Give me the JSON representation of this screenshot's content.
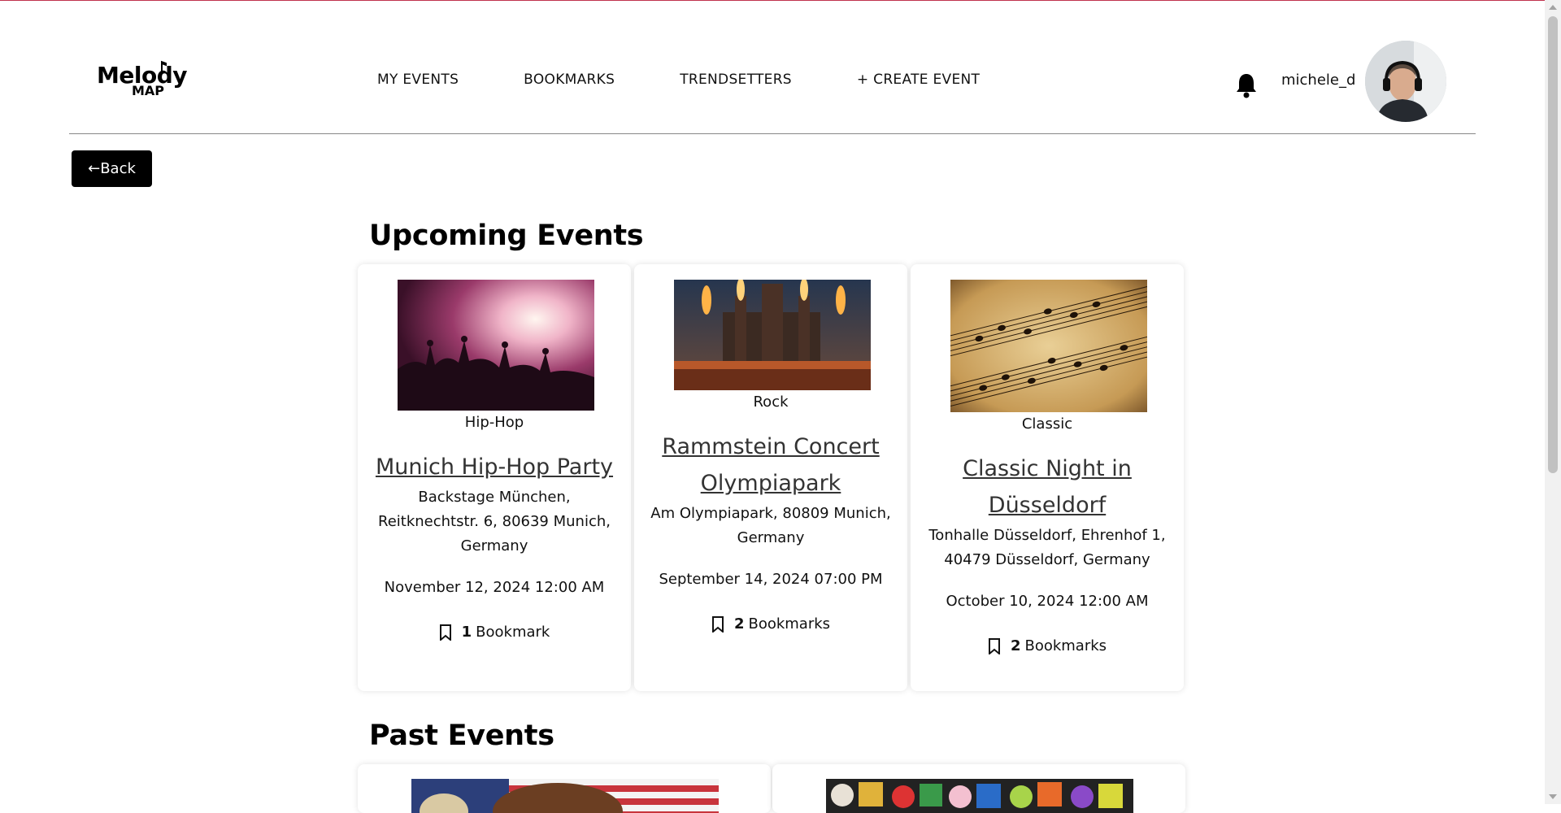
{
  "brand": {
    "line1": "Melody",
    "line2": "MAP"
  },
  "nav": {
    "my_events": "MY EVENTS",
    "bookmarks": "BOOKMARKS",
    "trendsetters": "TRENDSETTERS",
    "create_event": "+ CREATE EVENT"
  },
  "user": {
    "username": "michele_d"
  },
  "back_label": "←Back",
  "sections": {
    "upcoming": "Upcoming Events",
    "past": "Past Events"
  },
  "upcoming_events": [
    {
      "genre": "Hip-Hop",
      "title": "Munich Hip-Hop Party",
      "address": "Backstage München, Reitknechtstr. 6, 80639 Munich, Germany",
      "date": "November 12, 2024 12:00 AM",
      "bookmark_count": "1",
      "bookmark_label": "Bookmark"
    },
    {
      "genre": "Rock",
      "title": "Rammstein Concert Olympiapark",
      "address": "Am Olympiapark, 80809 Munich, Germany",
      "date": "September 14, 2024 07:00 PM",
      "bookmark_count": "2",
      "bookmark_label": "Bookmarks"
    },
    {
      "genre": "Classic",
      "title": "Classic Night in Düsseldorf",
      "address": "Tonhalle Düsseldorf, Ehrenhof 1, 40479 Düsseldorf, Germany",
      "date": "October 10, 2024 12:00 AM",
      "bookmark_count": "2",
      "bookmark_label": "Bookmarks"
    }
  ],
  "colors": {
    "accent_line": "#c0334d",
    "button_bg": "#000000",
    "text": "#111111"
  }
}
